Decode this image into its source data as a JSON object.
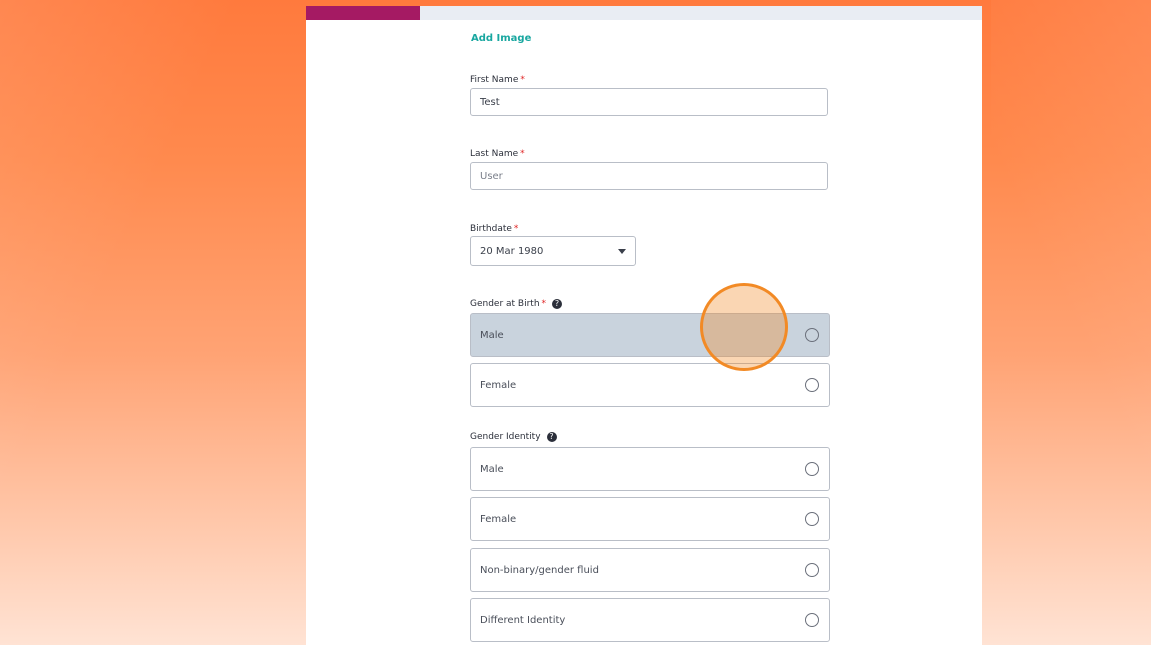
{
  "form": {
    "add_image_link": "Add Image",
    "required_marker": "*",
    "first_name": {
      "label": "First Name",
      "value": "Test"
    },
    "last_name": {
      "label": "Last Name",
      "placeholder": "User"
    },
    "birthdate": {
      "label": "Birthdate",
      "value": "20 Mar 1980"
    },
    "gender_at_birth": {
      "label": "Gender at Birth",
      "options": [
        "Male",
        "Female"
      ],
      "hovered_option": "Male"
    },
    "gender_identity": {
      "label": "Gender Identity",
      "options": [
        "Male",
        "Female",
        "Non-binary/gender fluid",
        "Different Identity"
      ]
    }
  },
  "icons": {
    "help": "question-circle-icon",
    "dropdown": "caret-down-icon",
    "radio": "radio-empty-icon"
  },
  "colors": {
    "brand_accent": "#a51a63",
    "link": "#19a7a0",
    "required": "#e02424",
    "hover_row": "#c9d3dd",
    "click_indicator": "#f28a25"
  }
}
